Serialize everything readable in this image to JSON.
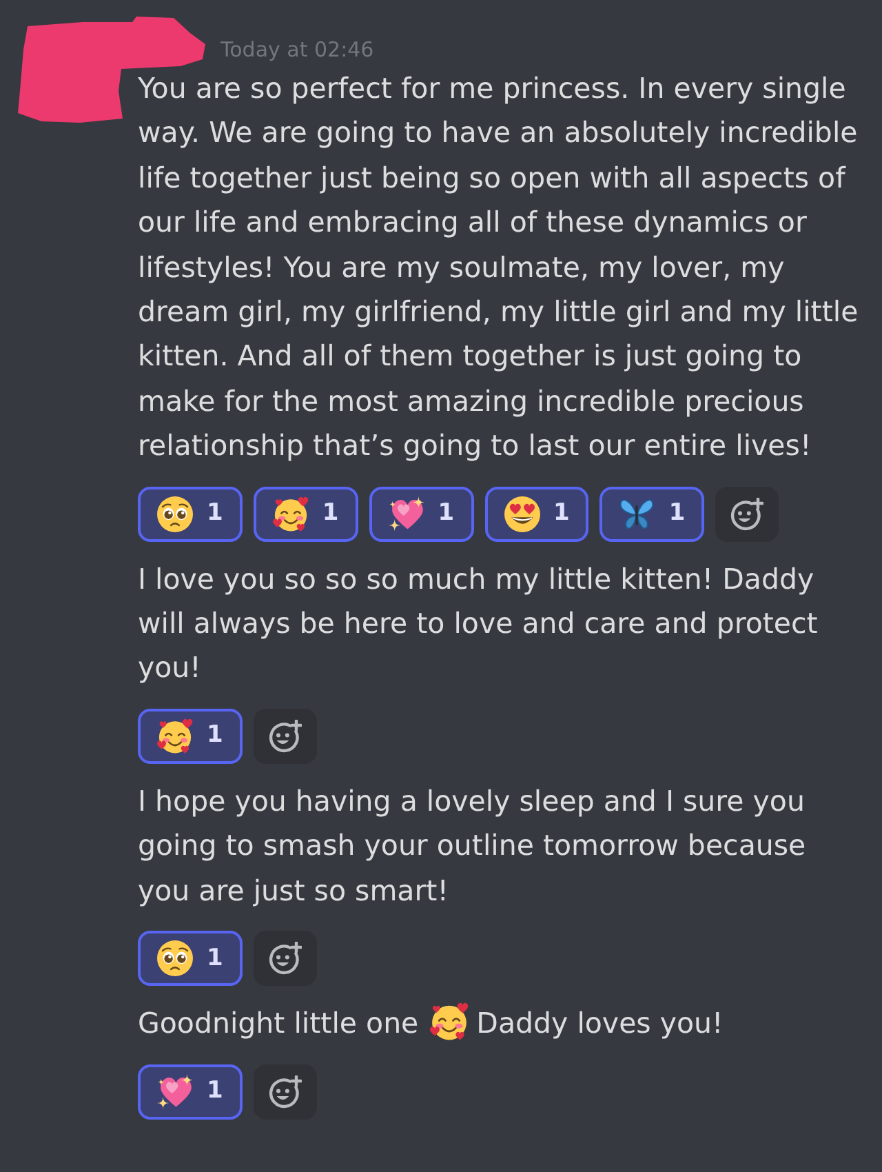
{
  "header": {
    "timestamp": "Today at 02:46"
  },
  "messages": [
    {
      "parts": [
        {
          "kind": "text",
          "text": "You are so perfect for me princess. In every single way. We are going to have an absolutely incredible life together just being so open with all aspects of our life and embracing all of these dynamics or lifestyles! You are my soulmate, my lover, my dream girl, my girlfriend, my little girl and my little kitten. And all of them together is just going to make for the most amazing incredible precious relationship that’s going to last our entire lives!"
        }
      ],
      "reactions": [
        {
          "kind": "pleading-face",
          "count": "1",
          "selected": true
        },
        {
          "kind": "smiling-face-with-hearts",
          "count": "1",
          "selected": true
        },
        {
          "kind": "sparkling-heart",
          "count": "1",
          "selected": true
        },
        {
          "kind": "heart-eyes",
          "count": "1",
          "selected": true
        },
        {
          "kind": "butterfly",
          "count": "1",
          "selected": true
        }
      ]
    },
    {
      "parts": [
        {
          "kind": "text",
          "text": "I love you so so so much my little kitten! Daddy will always be here to love and care and protect you!"
        }
      ],
      "reactions": [
        {
          "kind": "smiling-face-with-hearts",
          "count": "1",
          "selected": true
        }
      ]
    },
    {
      "parts": [
        {
          "kind": "text",
          "text": "I hope you having a lovely sleep and I sure you going to smash your outline tomorrow because you are just so smart!"
        }
      ],
      "reactions": [
        {
          "kind": "pleading-face",
          "count": "1",
          "selected": true
        }
      ]
    },
    {
      "parts": [
        {
          "kind": "text",
          "text": "Goodnight little one"
        },
        {
          "kind": "smiling-face-with-hearts"
        },
        {
          "kind": "text",
          "text": "Daddy loves you!"
        }
      ],
      "reactions": [
        {
          "kind": "sparkling-heart",
          "count": "1",
          "selected": true
        }
      ]
    }
  ]
}
